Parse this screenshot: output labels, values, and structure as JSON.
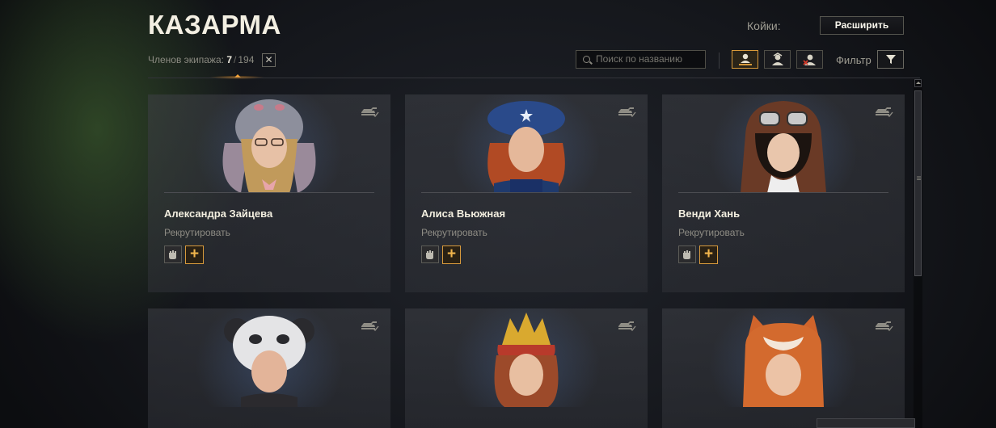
{
  "header": {
    "title": "КАЗАРМА",
    "crew_label": "Членов экипажа:",
    "crew_current": "7",
    "crew_separator": "/",
    "crew_total": "194",
    "clear_icon": "close-icon"
  },
  "bunks": {
    "label": "Койки:",
    "expand_label": "Расширить"
  },
  "toolbar": {
    "search_placeholder": "Поиск по названию",
    "filter_label": "Фильтр",
    "toggles": [
      "crew-in-tank-icon",
      "crew-in-barracks-icon",
      "crew-dismissed-icon"
    ],
    "accent_color": "#d99a3a"
  },
  "cards": [
    {
      "name": "Александра Зайцева",
      "action": "Рекрутировать",
      "headwear": "bunny-hat"
    },
    {
      "name": "Алиса Вьюжная",
      "action": "Рекрутировать",
      "headwear": "blue-beret"
    },
    {
      "name": "Венди Хань",
      "action": "Рекрутировать",
      "headwear": "aviator-cap"
    },
    {
      "name": "",
      "action": "",
      "headwear": "panda-hat"
    },
    {
      "name": "",
      "action": "",
      "headwear": "kokoshnik"
    },
    {
      "name": "",
      "action": "",
      "headwear": "fox-hood"
    }
  ]
}
